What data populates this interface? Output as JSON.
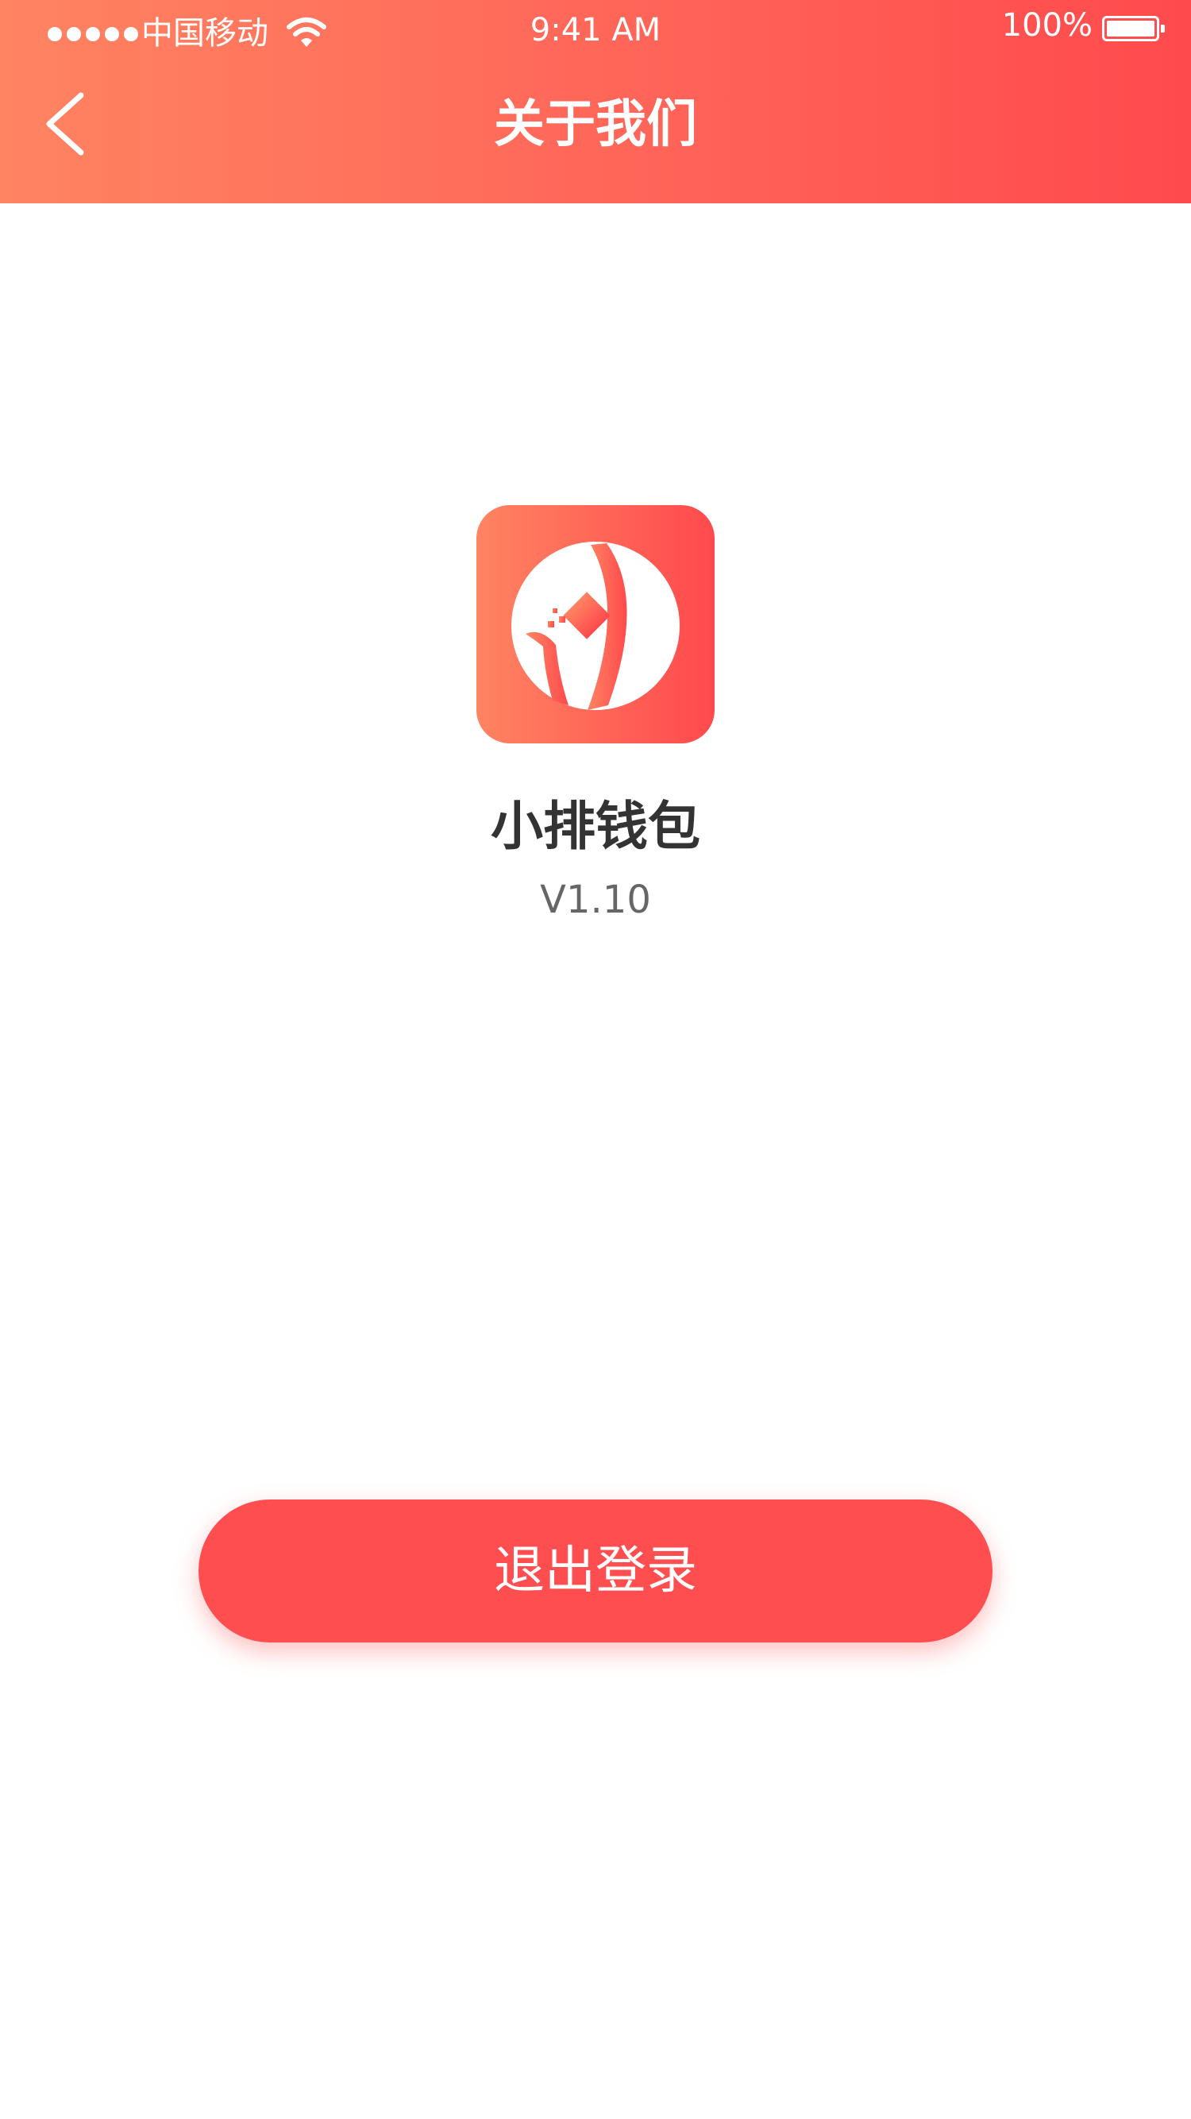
{
  "status_bar": {
    "carrier": "中国移动",
    "time": "9:41 AM",
    "battery": "100%"
  },
  "nav": {
    "title": "关于我们",
    "back_icon": "chevron-left-icon"
  },
  "app": {
    "name": "小排钱包",
    "version": "V1.10",
    "logo_icon": "app-logo-icon"
  },
  "actions": {
    "logout_label": "退出登录"
  },
  "colors": {
    "gradient_start": "#ff8462",
    "gradient_end": "#ff4a4d",
    "logout_button": "#ff4e4f",
    "app_name_text": "#333333",
    "version_text": "#666666"
  }
}
